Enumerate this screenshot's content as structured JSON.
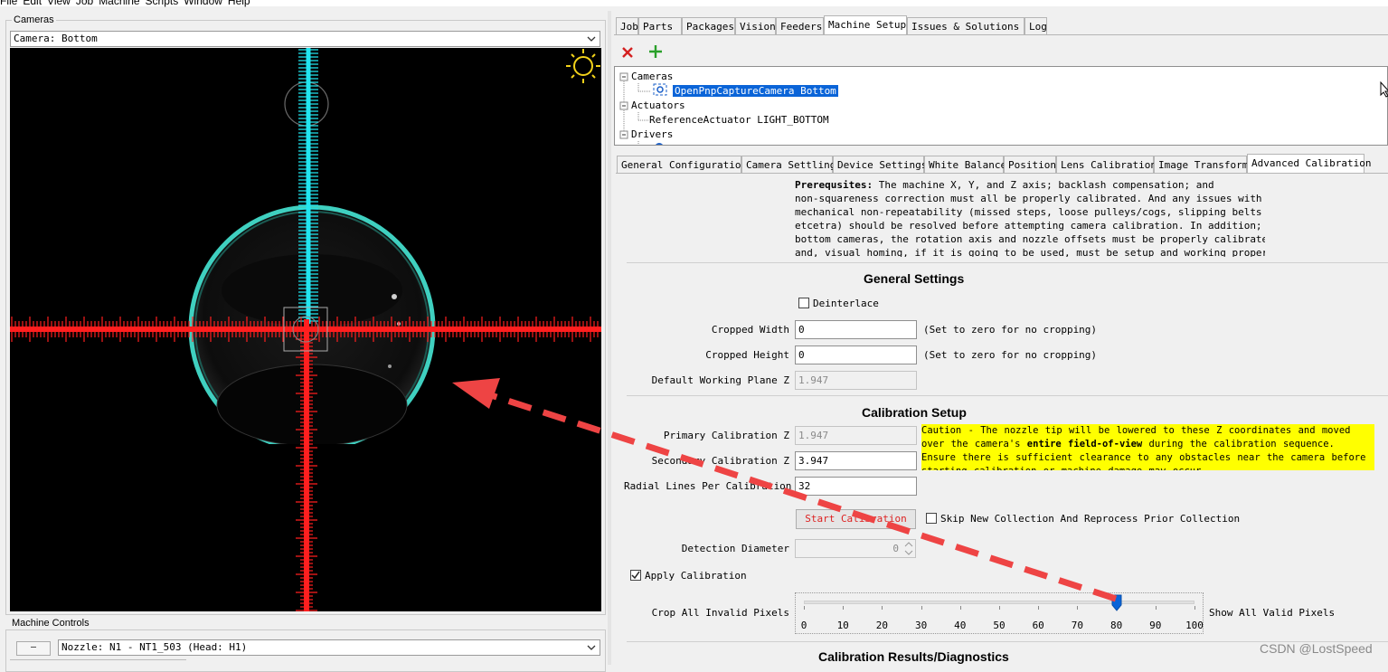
{
  "menu": [
    "File",
    "Edit",
    "View",
    "Job",
    "Machine",
    "Scripts",
    "Window",
    "Help"
  ],
  "cameras_panel": {
    "title": "Cameras",
    "selected_camera": "Camera: Bottom"
  },
  "machine_controls": {
    "title": "Machine Controls",
    "nozzle": "Nozzle: N1 - NT1_503 (Head: H1)",
    "minus_label": "—"
  },
  "main_tabs": [
    "Job",
    "Parts",
    "Packages",
    "Vision",
    "Feeders",
    "Machine Setup",
    "Issues & Solutions",
    "Log"
  ],
  "main_tab_selected": "Machine Setup",
  "tree": {
    "cameras_label": "Cameras",
    "camera_item": "OpenPnpCaptureCamera Bottom",
    "actuators_label": "Actuators",
    "actuator_item": "ReferenceActuator LIGHT_BOTTOM",
    "drivers_label": "Drivers"
  },
  "sub_tabs": [
    "General Configuration",
    "Camera Settling",
    "Device Settings",
    "White Balance",
    "Position",
    "Lens Calibration",
    "Image Transforms",
    "Advanced Calibration"
  ],
  "sub_tab_selected": "Advanced Calibration",
  "prereq": {
    "bold": "Prerequsites:",
    "lines": [
      " The machine X, Y, and Z axis; backlash compensation; and",
      "non-squareness correction must all be properly calibrated. And any issues with",
      "mechanical non-repeatability (missed steps, loose pulleys/cogs, slipping belts",
      "etcetra) should be resolved before attempting camera calibration. In addition; for",
      "bottom cameras, the rotation axis and nozzle offsets must be properly calibrated;",
      "and, visual homing, if it is going to be used, must be setup and working properly."
    ]
  },
  "general_settings": {
    "title": "General Settings",
    "deinterlace": "Deinterlace",
    "cropped_width_label": "Cropped Width",
    "cropped_width": "0",
    "cropped_width_hint": "(Set to zero for no cropping)",
    "cropped_height_label": "Cropped Height",
    "cropped_height": "0",
    "cropped_height_hint": "(Set to zero for no cropping)",
    "default_plane_label": "Default Working Plane Z",
    "default_plane": "1.947"
  },
  "calibration_setup": {
    "title": "Calibration Setup",
    "primary_label": "Primary Calibration Z",
    "primary": "1.947",
    "secondary_label": "Secondary Calibration Z",
    "secondary": "3.947",
    "radial_label": "Radial Lines Per Calibration Z",
    "radial": "32",
    "caution_prefix": "Caution - The nozzle tip will be lowered to these Z coordinates and moved over the camera's ",
    "caution_bold": "entire field-of-view",
    "caution_suffix": " during the calibration sequence. Ensure there is sufficient clearance to any obstacles near the camera before starting calibration or machine damage may occur.",
    "start_button": "Start Calibration",
    "skip_label": "Skip New Collection And Reprocess Prior Collection",
    "detection_label": "Detection Diameter",
    "detection_value": "0",
    "apply_label": "Apply Calibration",
    "apply_checked": true,
    "crop_label": "Crop All Invalid Pixels",
    "show_label": "Show All Valid Pixels",
    "slider_value": 80,
    "slider_ticks": [
      "0",
      "10",
      "20",
      "30",
      "40",
      "50",
      "60",
      "70",
      "80",
      "90",
      "100"
    ]
  },
  "results_title": "Calibration Results/Diagnostics",
  "watermark": "CSDN @LostSpeed",
  "colors": {
    "selection": "#0a64d8",
    "caution_bg": "#ffff00",
    "crosshair_red": "#ff1f1f",
    "crosshair_cyan": "#22e5f0",
    "ring": "#3fd0c0",
    "arrow": "#ee4444"
  }
}
